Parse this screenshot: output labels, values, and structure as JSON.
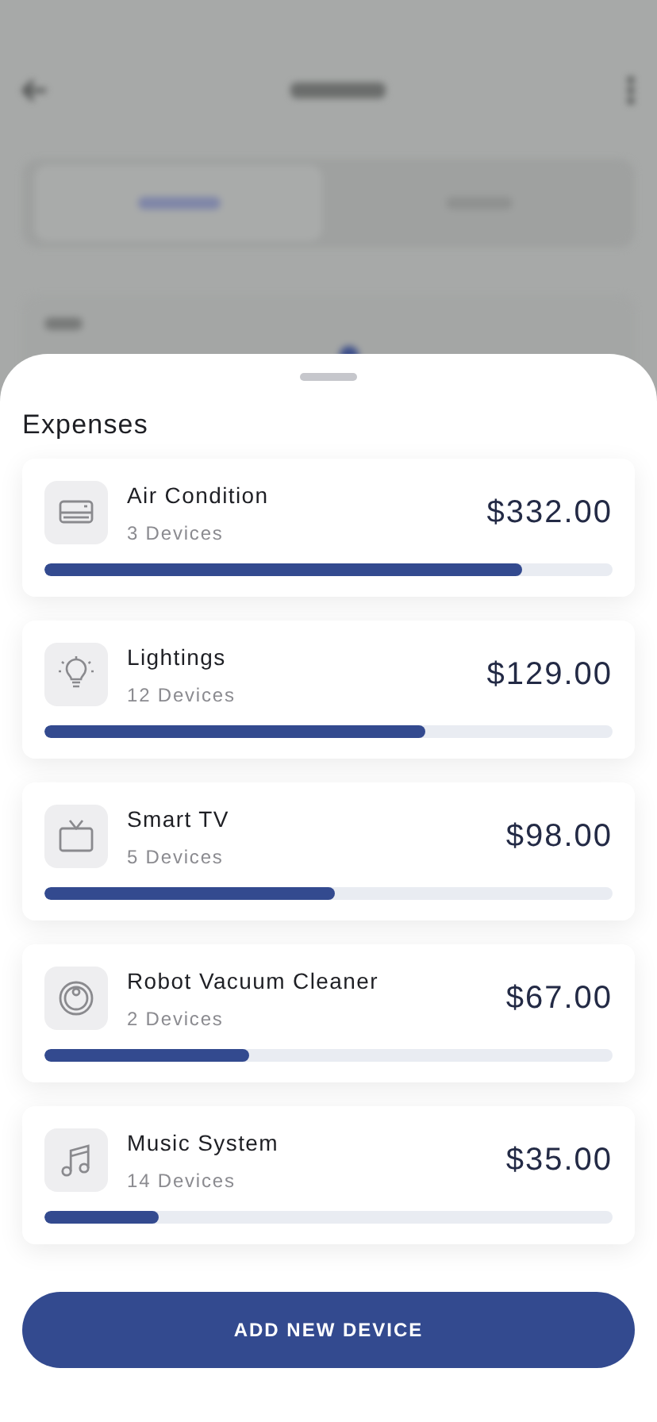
{
  "sheet": {
    "title": "Expenses",
    "items": [
      {
        "kind": "air-conditioner",
        "name": "Air Condition",
        "devices": "3 Devices",
        "amount": "$332.00",
        "level": 0.84
      },
      {
        "kind": "bulb",
        "name": "Lightings",
        "devices": "12 Devices",
        "amount": "$129.00",
        "level": 0.67
      },
      {
        "kind": "tv",
        "name": "Smart TV",
        "devices": "5 Devices",
        "amount": "$98.00",
        "level": 0.51
      },
      {
        "kind": "vacuum",
        "name": "Robot Vacuum Cleaner",
        "devices": "2 Devices",
        "amount": "$67.00",
        "level": 0.36
      },
      {
        "kind": "music",
        "name": "Music System",
        "devices": "14 Devices",
        "amount": "$35.00",
        "level": 0.2
      }
    ],
    "button": "ADD NEW DEVICE"
  }
}
